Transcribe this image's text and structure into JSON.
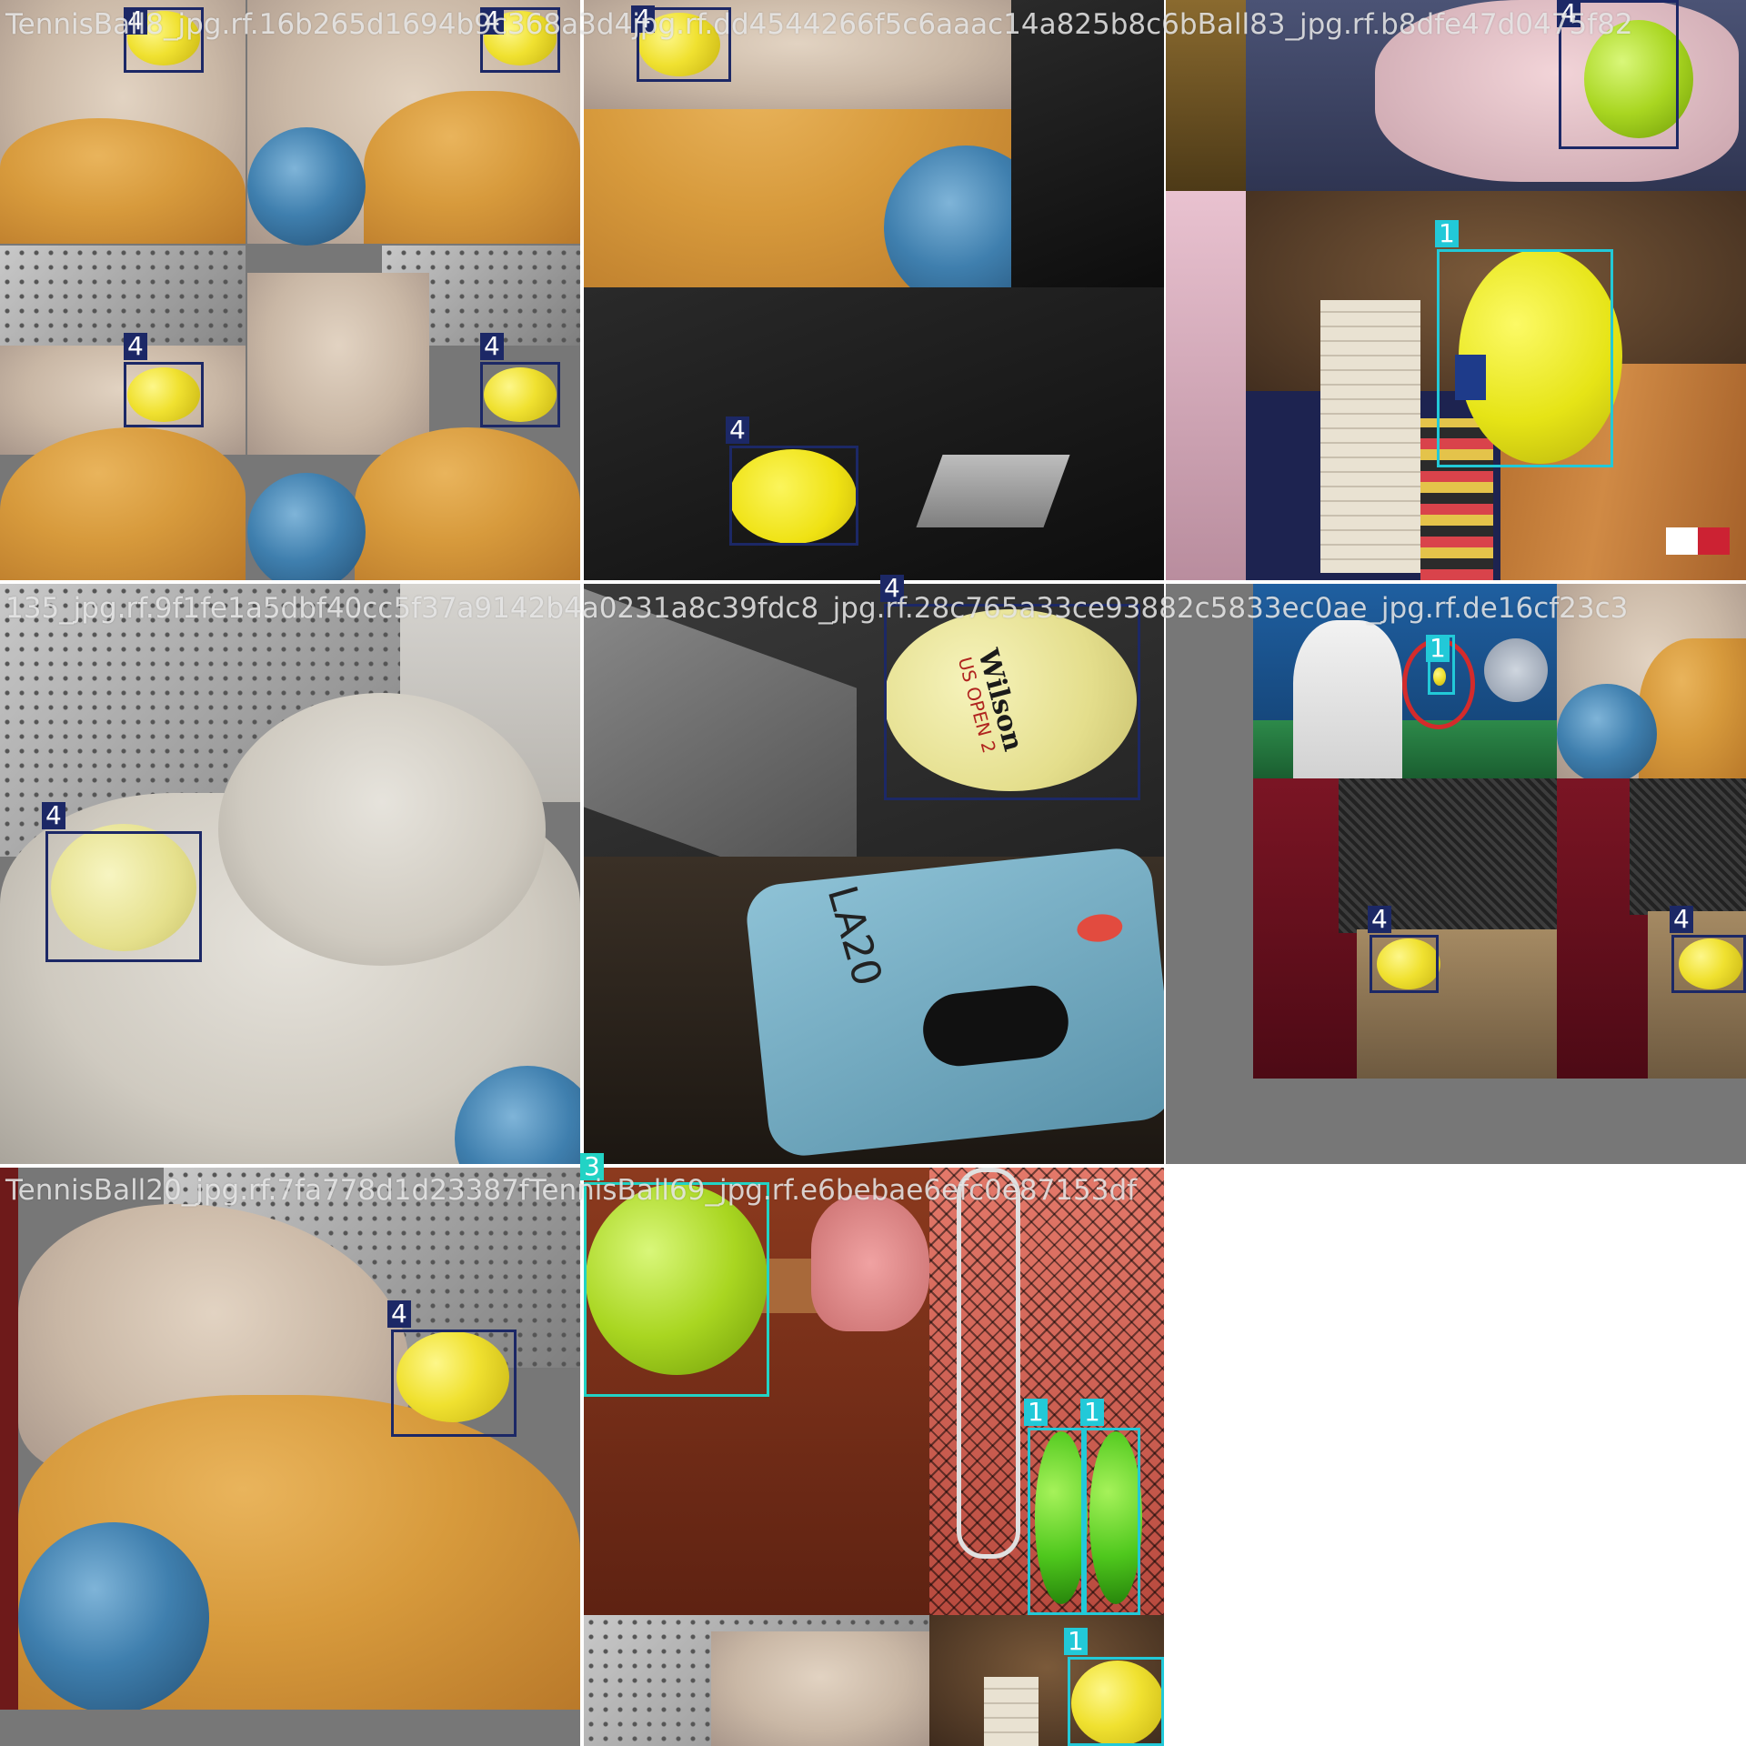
{
  "title_strip": {
    "row1": "TennisBall8_jpg.rf.16b265d1694b9c368a3d4jpg.rf.dd4544266f5c6aaac14a825b8c6bBall83_jpg.rf.b8dfe47d0475f82",
    "row2": "135_jpg.rf.9f1fe1a5dbf40cc5f37a9142b4a0231a8c39fdc8_jpg.rf.28c765a33ce93882c5833ec0ae_jpg.rf.de16cf23c3",
    "row3": "TennisBall20_jpg.rf.7fa778d1d23387fTennisBall69_jpg.rf.e6bebae6efc0e87153df"
  },
  "labels": {
    "c4": "4",
    "c1": "1",
    "c3": "3"
  },
  "colors": {
    "class4": "#1c2866",
    "class1": "#22c9d8",
    "class3": "#22d3c5"
  },
  "ball_text": {
    "line1": "Wilson",
    "line2": "US OPEN 2",
    "device": "LA20"
  }
}
